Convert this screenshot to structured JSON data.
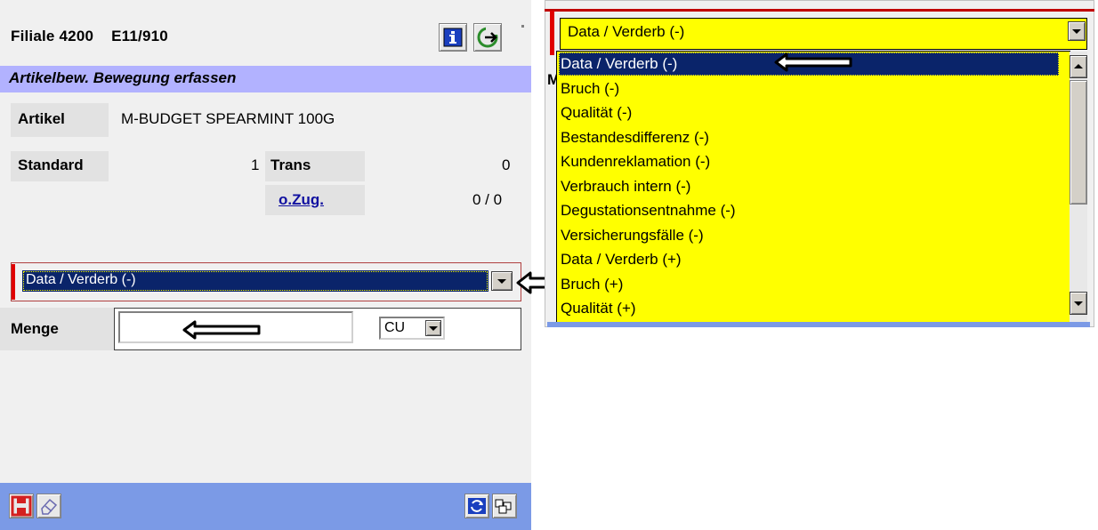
{
  "app": {
    "filiale": "Filiale 4200",
    "code": "E11/910",
    "screen_title": "Artikelbew. Bewegung erfassen"
  },
  "fields": {
    "artikel_label": "Artikel",
    "artikel_value": "M-BUDGET SPEARMINT 100G",
    "standard_label": "Standard",
    "standard_value": "1",
    "trans_label": "Trans",
    "trans_value": "0",
    "ozug_label": "o.Zug.",
    "ozug_value": "0 / 0"
  },
  "reason_combo": {
    "selected": "Data / Verderb (-)"
  },
  "menge": {
    "label": "Menge",
    "value": "",
    "unit": "CU"
  },
  "dropdown": {
    "selected": "Data / Verderb (-)",
    "options": [
      "Data / Verderb (-)",
      "Bruch (-)",
      "Qualität (-)",
      "Bestandesdifferenz (-)",
      "Kundenreklamation (-)",
      "Verbrauch intern (-)",
      "Degustationsentnahme (-)",
      "Versicherungsfälle (-)",
      "Data / Verderb (+)",
      "Bruch (+)",
      "Qualität (+)"
    ],
    "highlighted_index": 0,
    "partially_hidden_label_initial": "M"
  },
  "icons": {
    "toolbar": [
      "info-icon",
      "exit-icon"
    ],
    "footer": [
      "save-icon",
      "erase-icon",
      "refresh-icon",
      "keyboard-icon"
    ],
    "annotations": [
      "arrow-left-icon"
    ]
  },
  "colors": {
    "title_bar": "#b2b2ff",
    "footer_bar": "#7b9ae6",
    "selection": "#0a246a",
    "dropdown_bg": "#ffff00",
    "required_marker": "#e00000"
  }
}
